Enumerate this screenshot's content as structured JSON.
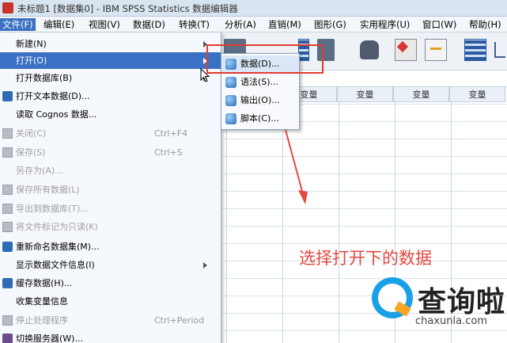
{
  "window": {
    "title": "未标题1 [数据集0] - IBM SPSS Statistics 数据编辑器"
  },
  "menubar": [
    {
      "label": "文件(F)",
      "active": true
    },
    {
      "label": "编辑(E)"
    },
    {
      "label": "视图(V)"
    },
    {
      "label": "数据(D)"
    },
    {
      "label": "转换(T)"
    },
    {
      "label": "分析(A)"
    },
    {
      "label": "直销(M)"
    },
    {
      "label": "图形(G)"
    },
    {
      "label": "实用程序(U)"
    },
    {
      "label": "窗口(W)"
    },
    {
      "label": "帮助(H)"
    }
  ],
  "file_menu": {
    "items": [
      {
        "label": "新建(N)",
        "submenu": true
      },
      {
        "label": "打开(O)",
        "submenu": true,
        "highlighted": true
      },
      {
        "label": "打开数据库(B)",
        "submenu": true
      },
      {
        "label": "打开文本数据(D)...",
        "icon": "text-data-icon"
      },
      {
        "label": "读取 Cognos 数据..."
      },
      {
        "label": "关闭(C)",
        "shortcut": "Ctrl+F4",
        "disabled": true,
        "icon": "close-file-icon"
      },
      {
        "label": "保存(S)",
        "shortcut": "Ctrl+S",
        "disabled": true,
        "icon": "save-icon"
      },
      {
        "label": "另存为(A)...",
        "disabled": true
      },
      {
        "label": "保存所有数据(L)",
        "disabled": true,
        "icon": "save-all-icon"
      },
      {
        "label": "导出到数据库(T)...",
        "disabled": true,
        "icon": "export-db-icon"
      },
      {
        "label": "将文件标记为只读(K)",
        "disabled": true,
        "icon": "lock-icon"
      },
      {
        "label": "重新命名数据集(M)...",
        "icon": "rename-icon"
      },
      {
        "label": "显示数据文件信息(I)",
        "submenu": true
      },
      {
        "label": "缓存数据(H)...",
        "icon": "cache-icon"
      },
      {
        "label": "收集变量信息"
      },
      {
        "label": "停止处理程序",
        "shortcut": "Ctrl+Period",
        "disabled": true,
        "icon": "stop-icon"
      },
      {
        "label": "切换服务器(W)...",
        "icon": "server-icon"
      }
    ]
  },
  "open_submenu": {
    "items": [
      {
        "label": "数据(D)...",
        "highlighted": true
      },
      {
        "label": "语法(S)..."
      },
      {
        "label": "输出(O)..."
      },
      {
        "label": "脚本(C)..."
      }
    ]
  },
  "grid": {
    "column_headers": [
      "变量",
      "变量",
      "变量",
      "变量"
    ]
  },
  "annotation": {
    "text": "选择打开下的数据",
    "color": "#e4493f"
  },
  "watermark": {
    "name": "查询啦",
    "domain": "chaxunla.com"
  }
}
